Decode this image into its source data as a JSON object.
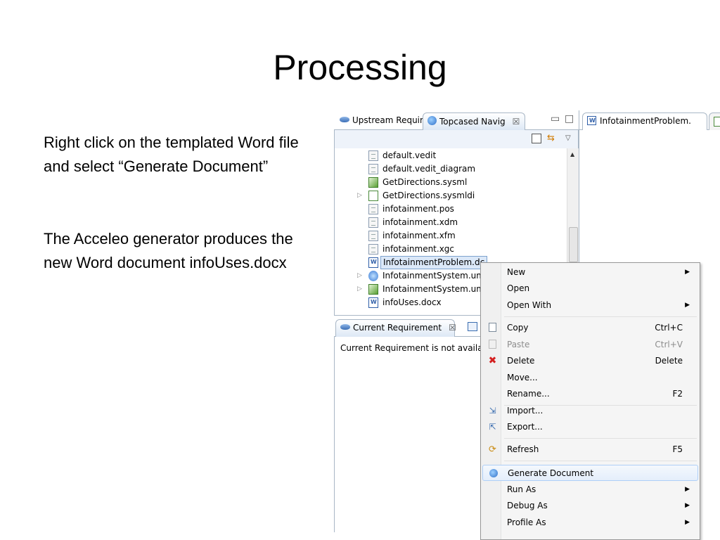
{
  "slide": {
    "title": "Processing",
    "para1": "Right click on the templated Word file and select “Generate Document”",
    "para2": "The Acceleo generator produces the new Word document infoUses.docx"
  },
  "ide": {
    "tabs": [
      {
        "label": "Upstream Requir",
        "icon": "requirement-eye-icon"
      },
      {
        "label": "Topcased Navig",
        "icon": "topcased-navigator-icon"
      }
    ],
    "close_glyph": "☒",
    "minimize_glyph": "▭",
    "maximize_glyph": "□",
    "tree": [
      {
        "label": "default.vedit",
        "icon": "file-icon"
      },
      {
        "label": "default.vedit_diagram",
        "icon": "file-icon"
      },
      {
        "label": "GetDirections.sysml",
        "icon": "sysml-model-icon"
      },
      {
        "label": "GetDirections.sysmldi",
        "icon": "sysml-diagram-icon",
        "expandable": true
      },
      {
        "label": "infotainment.pos",
        "icon": "file-icon"
      },
      {
        "label": "infotainment.xdm",
        "icon": "file-icon"
      },
      {
        "label": "infotainment.xfm",
        "icon": "file-icon"
      },
      {
        "label": "infotainment.xgc",
        "icon": "file-icon"
      },
      {
        "label": "InfotainmentProblem.dc",
        "icon": "word-doc-icon",
        "selected": true
      },
      {
        "label": "InfotainmentSystem.um",
        "icon": "uml-model-icon",
        "expandable": true
      },
      {
        "label": "InfotainmentSystem.um",
        "icon": "uml-diagram-icon",
        "expandable": true
      },
      {
        "label": "infoUses.docx",
        "icon": "word-doc-icon"
      }
    ],
    "bottom_panel": {
      "tab_label": "Current Requirement",
      "message": "Current Requirement is not availabl"
    },
    "editor_tab": {
      "label": "InfotainmentProblem."
    }
  },
  "context_menu": {
    "items": [
      {
        "label": "New",
        "submenu": true
      },
      {
        "label": "Open"
      },
      {
        "label": "Open With",
        "submenu": true
      },
      {
        "separator": true
      },
      {
        "label": "Copy",
        "shortcut": "Ctrl+C",
        "icon": "copy-icon"
      },
      {
        "label": "Paste",
        "shortcut": "Ctrl+V",
        "icon": "paste-icon",
        "disabled": true
      },
      {
        "label": "Delete",
        "shortcut": "Delete",
        "icon": "delete-icon"
      },
      {
        "label": "Move..."
      },
      {
        "label": "Rename...",
        "shortcut": "F2"
      },
      {
        "separator": true
      },
      {
        "label": "Import...",
        "icon": "import-icon"
      },
      {
        "label": "Export...",
        "icon": "export-icon"
      },
      {
        "separator": true
      },
      {
        "label": "Refresh",
        "shortcut": "F5",
        "icon": "refresh-icon"
      },
      {
        "separator": true
      },
      {
        "label": "Generate Document",
        "icon": "generate-document-icon",
        "hover": true
      },
      {
        "label": "Run As",
        "submenu": true
      },
      {
        "label": "Debug As",
        "submenu": true
      },
      {
        "label": "Profile As",
        "submenu": true
      }
    ],
    "submenu_glyph": "▶",
    "delete_glyph": "✖"
  },
  "colors": {
    "accent_border": "#a9b7c6",
    "hover_border": "#aecff7",
    "delete_red": "#d42020"
  }
}
